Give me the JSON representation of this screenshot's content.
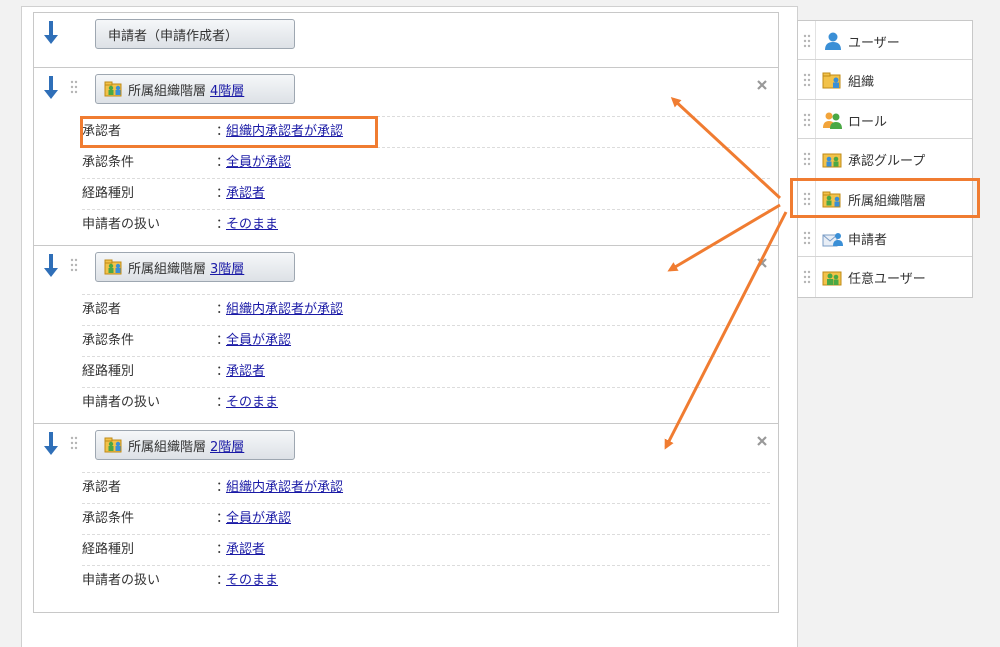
{
  "applicant_node": {
    "label": "申請者（申請作成者）"
  },
  "routes": [
    {
      "title": "所属組織階層",
      "level_link": "4階層",
      "rows": [
        {
          "label": "承認者",
          "value": "組織内承認者が承認"
        },
        {
          "label": "承認条件",
          "value": "全員が承認"
        },
        {
          "label": "経路種別",
          "value": "承認者"
        },
        {
          "label": "申請者の扱い",
          "value": "そのまま"
        }
      ]
    },
    {
      "title": "所属組織階層",
      "level_link": "3階層",
      "rows": [
        {
          "label": "承認者",
          "value": "組織内承認者が承認"
        },
        {
          "label": "承認条件",
          "value": "全員が承認"
        },
        {
          "label": "経路種別",
          "value": "承認者"
        },
        {
          "label": "申請者の扱い",
          "value": "そのまま"
        }
      ]
    },
    {
      "title": "所属組織階層",
      "level_link": "2階層",
      "rows": [
        {
          "label": "承認者",
          "value": "組織内承認者が承認"
        },
        {
          "label": "承認条件",
          "value": "全員が承認"
        },
        {
          "label": "経路種別",
          "value": "承認者"
        },
        {
          "label": "申請者の扱い",
          "value": "そのまま"
        }
      ]
    }
  ],
  "colon": "：",
  "palette": {
    "items": [
      {
        "label": "ユーザー",
        "icon": "user-icon"
      },
      {
        "label": "組織",
        "icon": "organization-icon"
      },
      {
        "label": "ロール",
        "icon": "role-icon"
      },
      {
        "label": "承認グループ",
        "icon": "approval-group-icon"
      },
      {
        "label": "所属組織階層",
        "icon": "org-hierarchy-icon"
      },
      {
        "label": "申請者",
        "icon": "applicant-icon"
      },
      {
        "label": "任意ユーザー",
        "icon": "any-user-icon"
      }
    ]
  },
  "colors": {
    "highlight": "#f07c31",
    "link": "#1a1aa6",
    "arrow": "#2f6fb8"
  }
}
